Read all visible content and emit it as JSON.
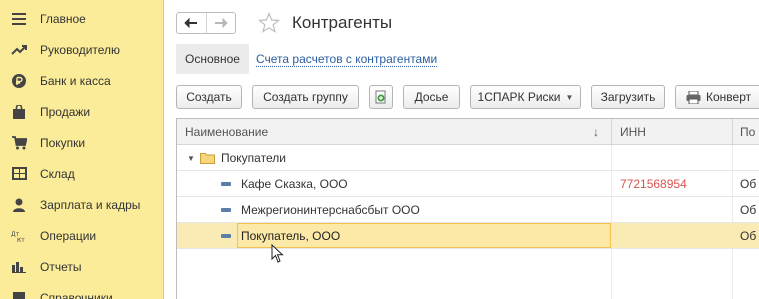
{
  "sidebar": {
    "items": [
      {
        "label": "Главное",
        "icon": "menu-icon"
      },
      {
        "label": "Руководителю",
        "icon": "trend-icon"
      },
      {
        "label": "Банк и касса",
        "icon": "ruble-icon"
      },
      {
        "label": "Продажи",
        "icon": "bag-icon"
      },
      {
        "label": "Покупки",
        "icon": "cart-icon"
      },
      {
        "label": "Склад",
        "icon": "warehouse-icon"
      },
      {
        "label": "Зарплата и кадры",
        "icon": "person-icon"
      },
      {
        "label": "Операции",
        "icon": "dt-kt-icon"
      },
      {
        "label": "Отчеты",
        "icon": "bar-chart-icon"
      },
      {
        "label": "Справочники",
        "icon": "book-icon"
      }
    ]
  },
  "header": {
    "title": "Контрагенты"
  },
  "subtabs": {
    "active": "Основное",
    "link": "Счета расчетов с контрагентами"
  },
  "toolbar": {
    "create": "Создать",
    "create_group": "Создать группу",
    "dossier": "Досье",
    "spark": "1СПАРК Риски",
    "load": "Загрузить",
    "envelope": "Конверт"
  },
  "table": {
    "columns": {
      "name": "Наименование",
      "inn": "ИНН",
      "third": "По"
    },
    "sort_indicator": "↓",
    "group": {
      "label": "Покупатели"
    },
    "rows": [
      {
        "name": "Кафе Сказка, ООО",
        "inn": "7721568954",
        "third": "Об"
      },
      {
        "name": "Межрегионинтерснабсбыт ООО",
        "inn": "",
        "third": "Об"
      },
      {
        "name": "Покупатель, ООО",
        "inn": "",
        "third": "Об"
      }
    ]
  },
  "colors": {
    "sidebar_bg": "#fbec9a",
    "link": "#2a5e9e",
    "inn_text": "#d9534f",
    "selected_row": "#f9ebb3",
    "focus_border": "#f2c14e"
  }
}
